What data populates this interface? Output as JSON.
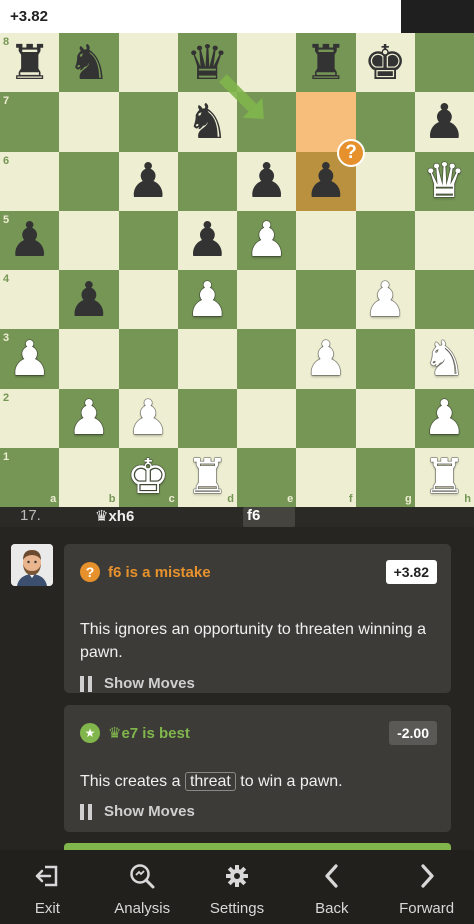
{
  "eval_bar": {
    "text": "+3.82",
    "white_fraction": 0.845
  },
  "board": {
    "files": [
      "a",
      "b",
      "c",
      "d",
      "e",
      "f",
      "g",
      "h"
    ],
    "ranks": [
      "8",
      "7",
      "6",
      "5",
      "4",
      "3",
      "2",
      "1"
    ],
    "highlight_from": "f7",
    "highlight_to": "f6",
    "mistake_badge": "?",
    "pieces": [
      {
        "sq": "a8",
        "c": "b",
        "p": "rook"
      },
      {
        "sq": "b8",
        "c": "b",
        "p": "knight"
      },
      {
        "sq": "d8",
        "c": "b",
        "p": "queen"
      },
      {
        "sq": "f8",
        "c": "b",
        "p": "rook"
      },
      {
        "sq": "g8",
        "c": "b",
        "p": "king"
      },
      {
        "sq": "d7",
        "c": "b",
        "p": "knight"
      },
      {
        "sq": "h7",
        "c": "b",
        "p": "pawn"
      },
      {
        "sq": "c6",
        "c": "b",
        "p": "pawn"
      },
      {
        "sq": "e6",
        "c": "b",
        "p": "pawn"
      },
      {
        "sq": "f6",
        "c": "b",
        "p": "pawn"
      },
      {
        "sq": "h6",
        "c": "w",
        "p": "queen"
      },
      {
        "sq": "a5",
        "c": "b",
        "p": "pawn"
      },
      {
        "sq": "d5",
        "c": "b",
        "p": "pawn"
      },
      {
        "sq": "e5",
        "c": "w",
        "p": "pawn"
      },
      {
        "sq": "b4",
        "c": "b",
        "p": "pawn"
      },
      {
        "sq": "d4",
        "c": "w",
        "p": "pawn"
      },
      {
        "sq": "g4",
        "c": "w",
        "p": "pawn"
      },
      {
        "sq": "a3",
        "c": "w",
        "p": "pawn"
      },
      {
        "sq": "f3",
        "c": "w",
        "p": "pawn"
      },
      {
        "sq": "h3",
        "c": "w",
        "p": "knight"
      },
      {
        "sq": "b2",
        "c": "w",
        "p": "pawn"
      },
      {
        "sq": "c2",
        "c": "w",
        "p": "pawn"
      },
      {
        "sq": "h2",
        "c": "w",
        "p": "pawn"
      },
      {
        "sq": "c1",
        "c": "w",
        "p": "king"
      },
      {
        "sq": "d1",
        "c": "w",
        "p": "rook"
      },
      {
        "sq": "h1",
        "c": "w",
        "p": "rook"
      }
    ],
    "arrow": {
      "from": "d8",
      "to": "e7",
      "color": "#81b64c"
    }
  },
  "move_bar": {
    "move_number": "17.",
    "white_move": "♛xh6",
    "black_move": "f6"
  },
  "feedback": {
    "mistake": {
      "icon": "?",
      "title": "f6 is a mistake",
      "score": "+3.82",
      "body": "This ignores an opportunity to threaten winning a pawn.",
      "show_moves": "Show Moves"
    },
    "best": {
      "icon": "★",
      "title": "♛e7 is best",
      "score": "-2.00",
      "body_pre": "This creates a ",
      "body_link": "threat",
      "body_post": " to win a pawn.",
      "show_moves": "Show Moves"
    }
  },
  "toolbar": {
    "exit": "Exit",
    "analysis": "Analysis",
    "settings": "Settings",
    "back": "Back",
    "forward": "Forward"
  },
  "colors": {
    "light_square": "#eeeed2",
    "dark_square": "#769656",
    "mistake": "#e6912c",
    "best": "#81b64c"
  }
}
